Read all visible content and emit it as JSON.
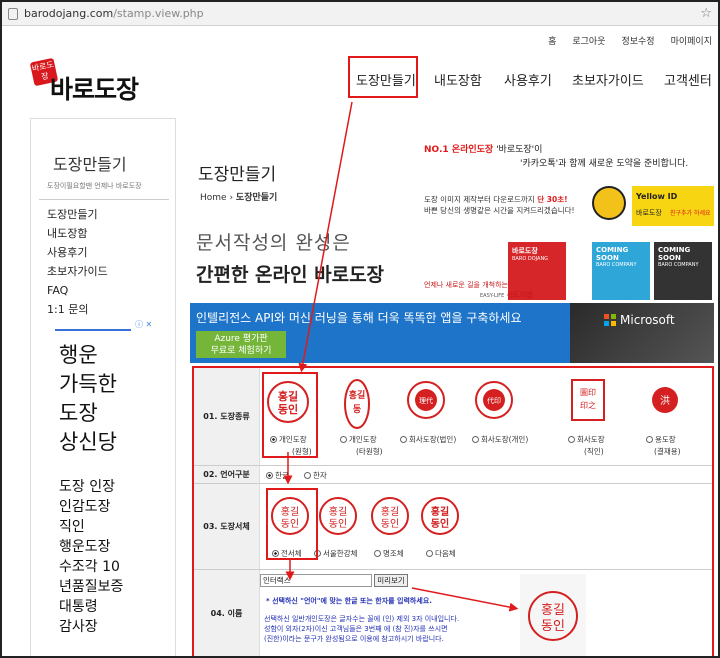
{
  "browser": {
    "url_host": "barodojang.com",
    "url_path": "/stamp.view.php",
    "star_icon": "star-icon"
  },
  "util_links": [
    "홈",
    "로그아웃",
    "정보수정",
    "마이페이지"
  ],
  "logo": {
    "badge": "바로도장",
    "text": "바로도장"
  },
  "nav": [
    "도장만들기",
    "내도장함",
    "사용후기",
    "초보자가이드",
    "고객센터"
  ],
  "sidebar": {
    "title": "도장만들기",
    "subtitle": "도장이필요할땐 언제나 바로도장",
    "menu": [
      "도장만들기",
      "내도장함",
      "사용후기",
      "초보자가이드",
      "FAQ",
      "1:1 문의"
    ],
    "ad_big": [
      "행운",
      "가득한",
      "도장",
      "상신당"
    ],
    "ad_small": [
      "도장 인장",
      "인감도장",
      "직인",
      "행운도장",
      "수조각 10",
      "년품질보증",
      "대통령",
      "감사장"
    ]
  },
  "content": {
    "page_title": "도장만들기",
    "breadcrumb_home": "Home",
    "breadcrumb_current": "도장만들기",
    "tagline1": "문서작성의 완성은",
    "tagline2": "간편한 온라인 바로도장"
  },
  "promo": {
    "line1_red": "NO.1 온라인도장",
    "line1_rest": " '바로도장'이",
    "line2": "'카카오톡'과 함께 새로운 도약을 준비합니다.",
    "line3a": "도장 이미지 제작부터 다운로드까지",
    "line3a_red": " 단 30초!",
    "line3b": "바쁜 당신의 생명같은 시간을 지켜드리겠습니다!",
    "yellow_id": "Yellow ID",
    "yellow_brand": "바로도장",
    "yellow_cta": "친구추가 하세요",
    "tiles": [
      "바로도장",
      "COMING SOON",
      "COMING SOON"
    ],
    "tile_sub": [
      "BARO DOJANG",
      "BARO COMPANY",
      "BARO COMPANY"
    ],
    "line4": "언제나 새로운 길을 개척하는",
    "line5": "선도기업",
    "line5_pre": "EASY-LIFE"
  },
  "ms_banner": {
    "headline": "인텔리전스 API와 머신 러닝을 통해 더욱 똑똑한 앱을 구축하세요",
    "btn_line1": "Azure 평가판",
    "btn_line2": "무료로 체험하기",
    "brand": "Microsoft"
  },
  "form": {
    "row1_label": "01. 도장종류",
    "row1_options": [
      "개인도장",
      "개인도장",
      "회사도장(법인)",
      "회사도장(개인)",
      "회사도장",
      "용도장"
    ],
    "row1_sub": [
      "(원형)",
      "(타원형)",
      "",
      "",
      "(직인)",
      "(결재용)"
    ],
    "row2_label": "02. 언어구분",
    "row2_options": [
      "한글",
      "한자"
    ],
    "row3_label": "03. 도장서체",
    "row3_options": [
      "전서체",
      "서울한강체",
      "명조체",
      "다음체"
    ],
    "row4_label": "04. 이름",
    "name_value": "인터랙스",
    "preview_btn": "미리보기",
    "note1": "* 선택하신 \"언어\"에 맞는 한글 또는 한자를 입력하세요.",
    "note2a": "선택하신 일반개인도장은 글자수는 꼴에 (인) 제외 3자 이내입니다.",
    "note2b": "성함이 외자(2자)이신 고객님들은 3번째 에 (참 진)자를 쓰시면",
    "note2c": "(진한)이라는 문구가 완성됨으로 이용에 참고하시기 바랍니다.",
    "stamp_sample_chars": "홍길동인"
  },
  "colors": {
    "accent_red": "#e01a1a",
    "ms_blue": "#1e74c8",
    "azure_green": "#74b53a",
    "kakao_yellow": "#f7d513"
  }
}
